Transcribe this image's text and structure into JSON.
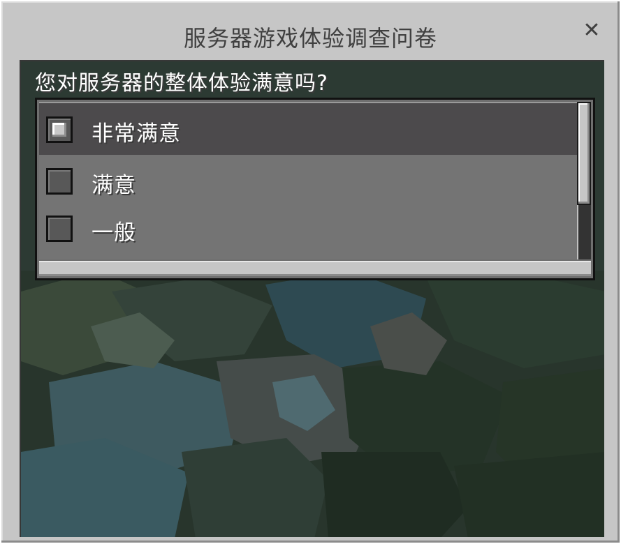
{
  "dialog": {
    "title": "服务器游戏体验调查问卷",
    "close_label": "✕"
  },
  "question": {
    "text": "您对服务器的整体体验满意吗?"
  },
  "options": [
    {
      "label": "非常满意",
      "checked": true,
      "selected": true
    },
    {
      "label": "满意",
      "checked": false,
      "selected": false
    },
    {
      "label": "一般",
      "checked": false,
      "selected": false
    }
  ],
  "colors": {
    "panel": "#c6c6c6",
    "list_bg": "#747474",
    "selected_row": "#4c4a4c",
    "text_light": "#ffffff",
    "text_dark": "#404040"
  }
}
